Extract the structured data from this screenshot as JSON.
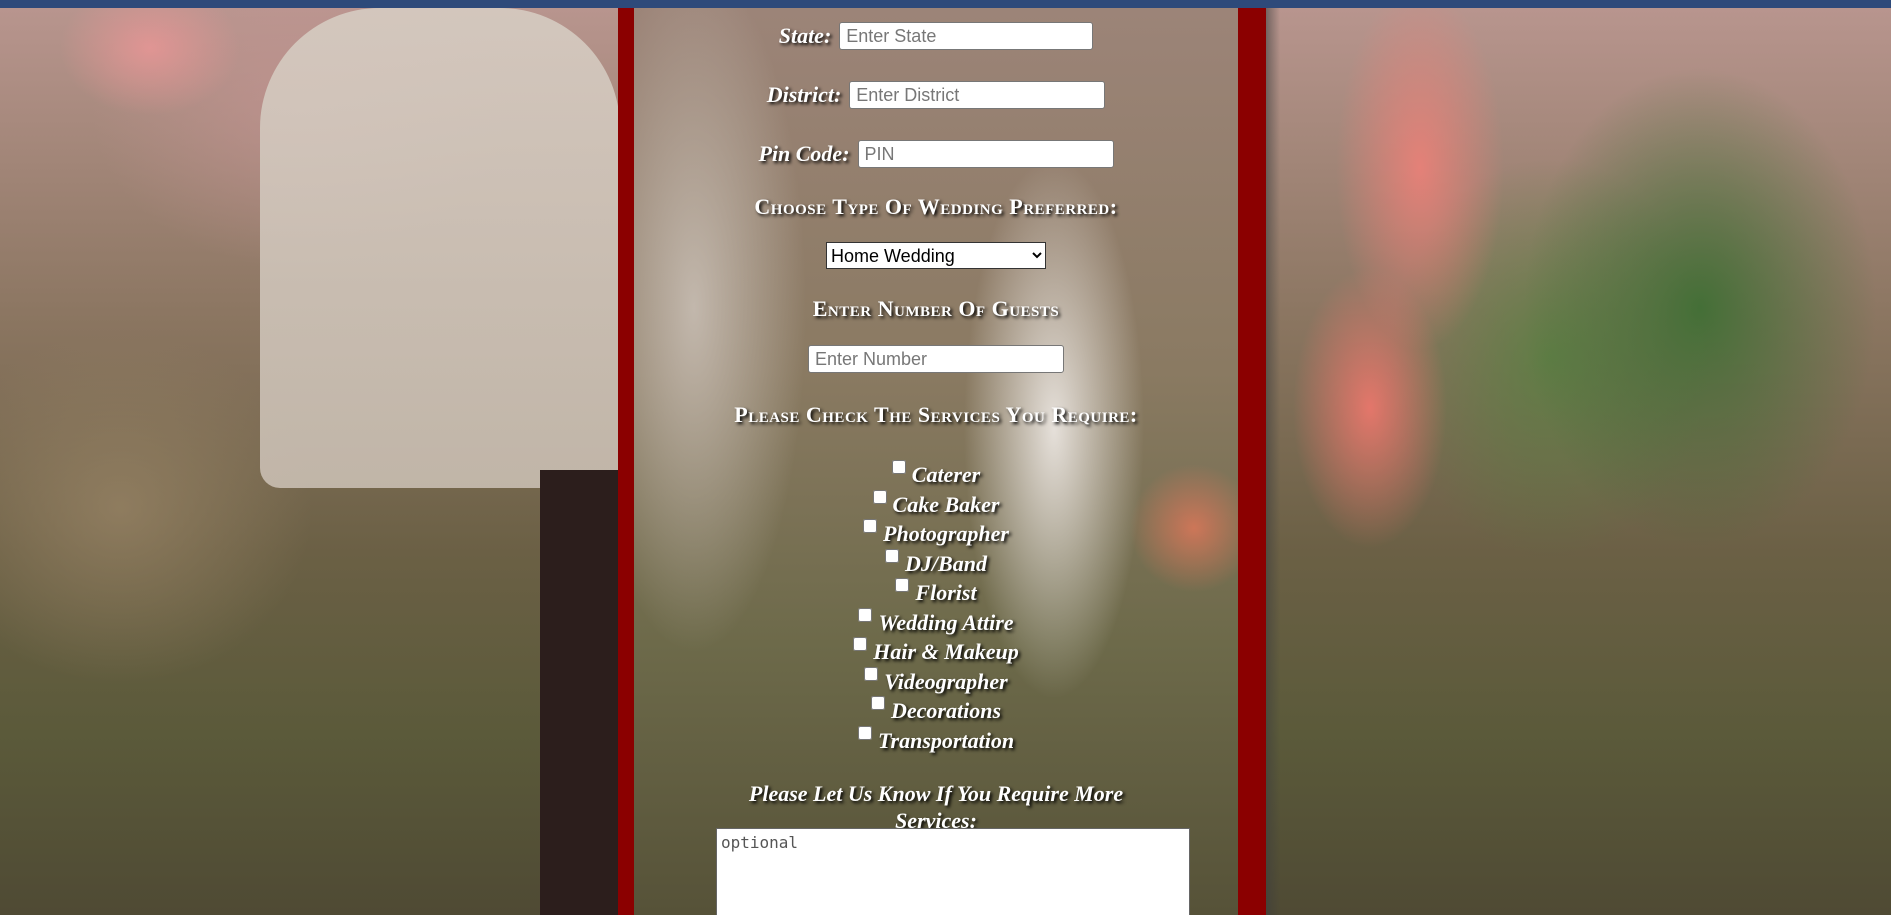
{
  "fields": {
    "state": {
      "label": "State:",
      "placeholder": "Enter State"
    },
    "district": {
      "label": "District:",
      "placeholder": "Enter District"
    },
    "pin": {
      "label": "Pin Code:",
      "placeholder": "PIN"
    }
  },
  "wedding_type": {
    "heading": "Choose Type Of Wedding Preferred:",
    "selected": "Home Wedding"
  },
  "guests": {
    "heading": "Enter Number Of Guests",
    "placeholder": "Enter Number"
  },
  "services": {
    "heading": "Please Check The Services You Require:",
    "items": [
      {
        "label": "Caterer"
      },
      {
        "label": "Cake Baker"
      },
      {
        "label": "Photographer"
      },
      {
        "label": "DJ/Band"
      },
      {
        "label": "Florist"
      },
      {
        "label": "Wedding Attire"
      },
      {
        "label": "Hair & Makeup"
      },
      {
        "label": "Videographer"
      },
      {
        "label": "Decorations"
      },
      {
        "label": "Transportation"
      }
    ]
  },
  "more_services": {
    "line1": "Please Let Us Know If You Require More",
    "line2": "Services:",
    "placeholder": "optional"
  },
  "colors": {
    "panel": "#8b0000",
    "topbar": "#2e4a7a"
  }
}
